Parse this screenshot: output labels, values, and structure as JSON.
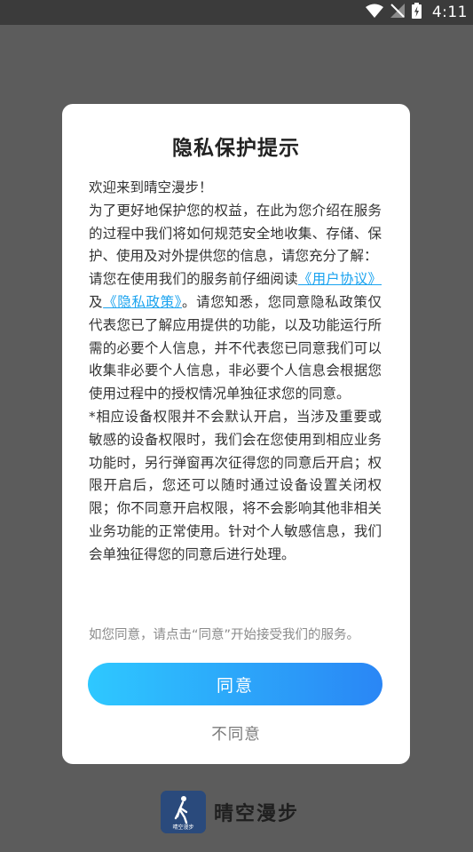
{
  "status_bar": {
    "time": "4:11",
    "icons": [
      "wifi-icon",
      "signal-icon",
      "battery-charging-icon"
    ]
  },
  "dialog": {
    "title": "隐私保护提示",
    "body": {
      "p1": "欢迎来到晴空漫步！",
      "p2": "为了更好地保护您的权益，在此为您介绍在服务的过程中我们将如何规范安全地收集、存储、保护、使用及对外提供您的信息，请您充分了解：",
      "p3_prefix": "请您在使用我们的服务前仔细阅读",
      "user_agreement_link": "《用户协议》",
      "p3_and": "及",
      "privacy_policy_link": "《隐私政策》",
      "p3_suffix": "。请您知悉，您同意隐私政策仅代表您已了解应用提供的功能，以及功能运行所需的必要个人信息，并不代表您已同意我们可以收集非必要个人信息，非必要个人信息会根据您使用过程中的授权情况单独征求您的同意。",
      "p4": "*相应设备权限并不会默认开启，当涉及重要或敏感的设备权限时，我们会在您使用到相应业务功能时，另行弹窗再次征得您的同意后开启；权限开启后，您还可以随时通过设备设置关闭权限；你不同意开启权限，将不会影响其他非相关业务功能的正常使用。针对个人敏感信息，我们会单独征得您的同意后进行处理。"
    },
    "hint": "如您同意，请点击“同意”开始接受我们的服务。",
    "agree_label": "同意",
    "disagree_label": "不同意"
  },
  "brand": {
    "logo_caption": "晴空漫步",
    "name": "晴空漫步"
  },
  "colors": {
    "link": "#1aa3ef",
    "button_gradient_start": "#2ec8ff",
    "button_gradient_end": "#2a86f5",
    "overlay": "#5c5c5c"
  }
}
